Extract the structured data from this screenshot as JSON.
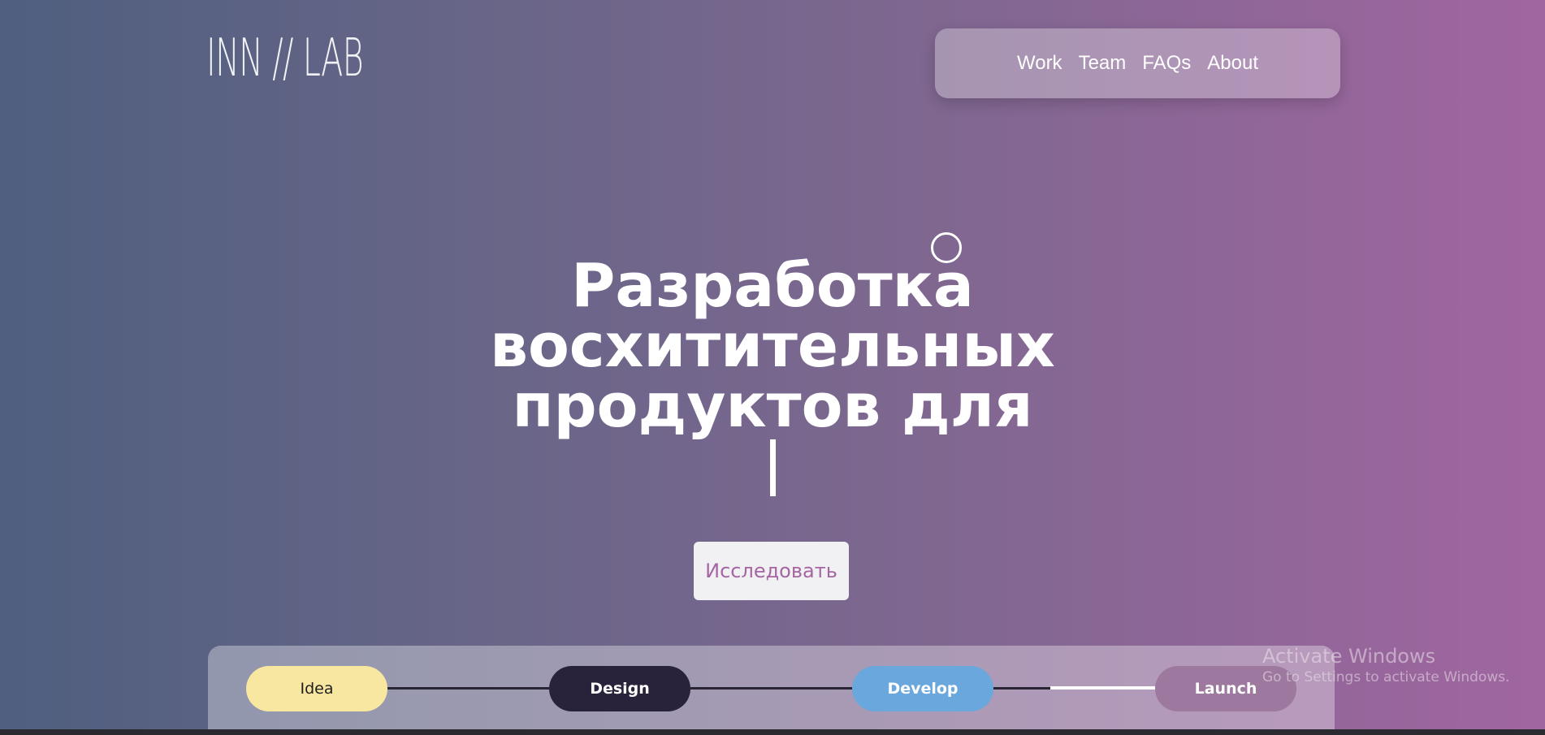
{
  "header": {
    "logo_text": "INN // LAB"
  },
  "nav": {
    "items": [
      {
        "label": "Work"
      },
      {
        "label": "Team"
      },
      {
        "label": "FAQs"
      },
      {
        "label": "About"
      }
    ]
  },
  "hero": {
    "line1": "Разработка восхитительных",
    "line2": "продуктов для"
  },
  "cta": {
    "label": "Исследовать"
  },
  "timeline": {
    "stages": [
      {
        "label": "Idea",
        "color": "#f8e7a0"
      },
      {
        "label": "Design",
        "color": "#28223a"
      },
      {
        "label": "Develop",
        "color": "#6aa7dc"
      },
      {
        "label": "Launch",
        "color": "#966e96"
      }
    ]
  },
  "os_watermark": {
    "title": "Activate Windows",
    "subtitle": "Go to Settings to activate Windows."
  }
}
